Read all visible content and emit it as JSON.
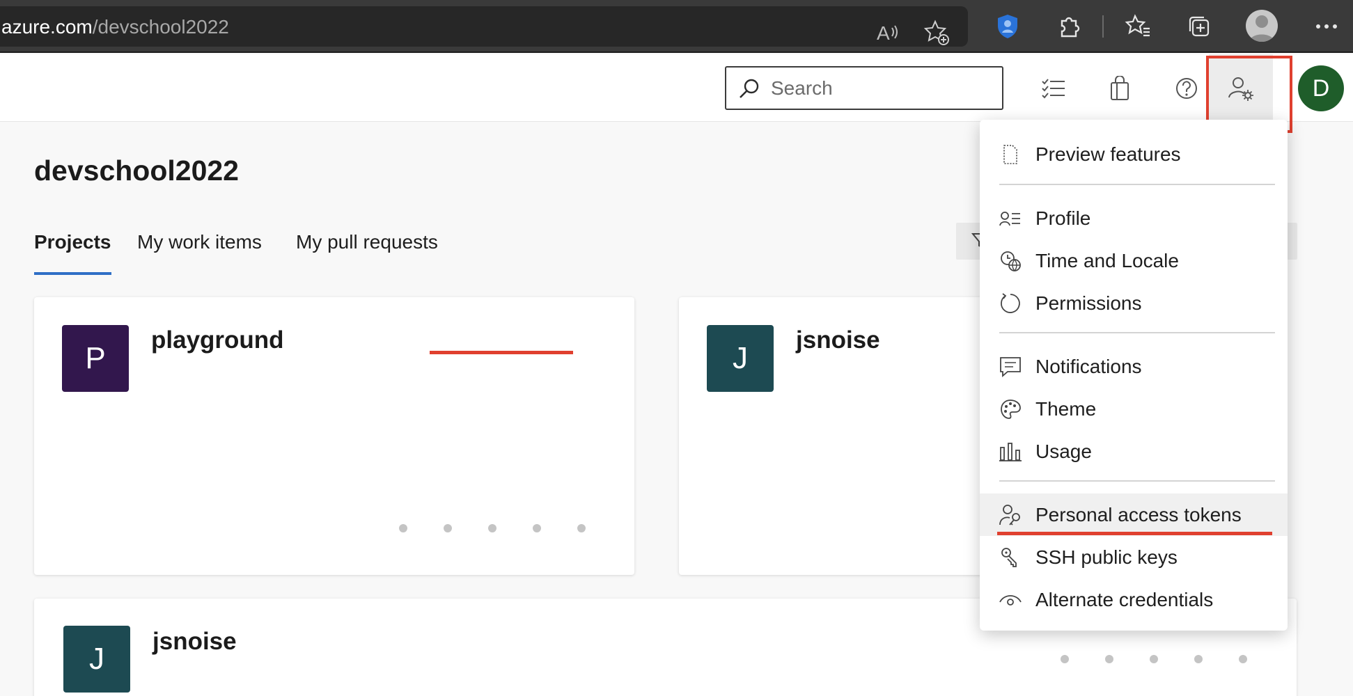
{
  "browser": {
    "url_host": "azure.com",
    "url_path": "/devschool2022",
    "icons": [
      "read-aloud-icon",
      "add-favorite-icon",
      "shield-extension-icon",
      "extensions-icon",
      "favorites-icon",
      "collections-icon",
      "profile-icon",
      "more-icon"
    ]
  },
  "header": {
    "search_placeholder": "Search",
    "icons": [
      "task-list-icon",
      "shopping-bag-icon",
      "help-icon",
      "user-settings-icon"
    ],
    "avatar_letter": "D",
    "avatar_color": "#1f5d2a",
    "highlight_color": "#e0402f"
  },
  "page": {
    "title": "devschool2022",
    "tabs": [
      {
        "label": "Projects",
        "active": true
      },
      {
        "label": "My work items",
        "active": false
      },
      {
        "label": "My pull requests",
        "active": false
      }
    ]
  },
  "projects": [
    {
      "letter": "P",
      "name": "playground",
      "color": "#32174d"
    },
    {
      "letter": "J",
      "name": "jsnoise",
      "color": "#1d4a52"
    },
    {
      "letter": "J",
      "name": "jsnoise",
      "color": "#1d4a52"
    }
  ],
  "menu": {
    "items": [
      {
        "label": "Preview features",
        "icon": "document-icon"
      },
      {
        "label": "Profile",
        "icon": "profile-card-icon"
      },
      {
        "label": "Time and Locale",
        "icon": "clock-globe-icon"
      },
      {
        "label": "Permissions",
        "icon": "refresh-circle-icon"
      },
      {
        "label": "Notifications",
        "icon": "chat-bubble-icon"
      },
      {
        "label": "Theme",
        "icon": "palette-icon"
      },
      {
        "label": "Usage",
        "icon": "bar-chart-icon"
      },
      {
        "label": "Personal access tokens",
        "icon": "person-key-icon",
        "highlighted": true
      },
      {
        "label": "SSH public keys",
        "icon": "ssh-key-icon"
      },
      {
        "label": "Alternate credentials",
        "icon": "eye-icon"
      }
    ]
  }
}
